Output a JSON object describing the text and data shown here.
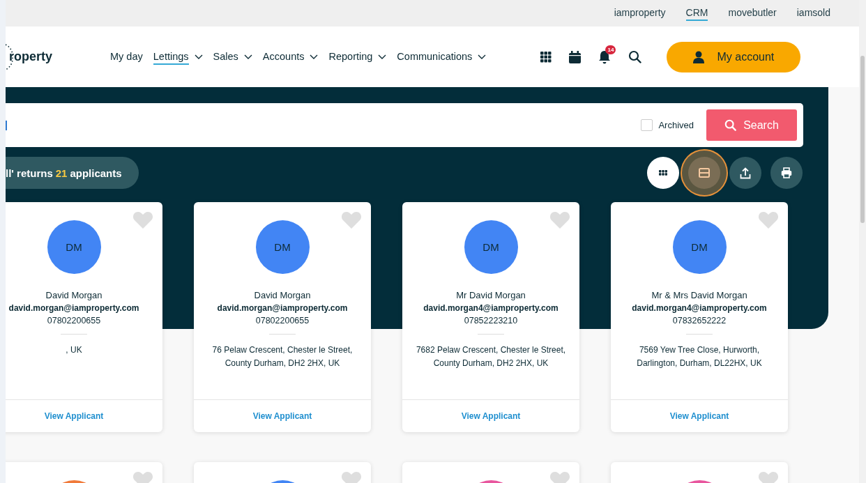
{
  "top_links": [
    {
      "label": "iamproperty",
      "selected": false
    },
    {
      "label": "CRM",
      "selected": true
    },
    {
      "label": "movebutler",
      "selected": false
    },
    {
      "label": "iamsold",
      "selected": false
    }
  ],
  "logo": {
    "text": "roperty"
  },
  "nav": [
    {
      "label": "My day",
      "selected": false,
      "dropdown": false
    },
    {
      "label": "Lettings",
      "selected": true,
      "dropdown": true
    },
    {
      "label": "Sales",
      "selected": false,
      "dropdown": true
    },
    {
      "label": "Accounts",
      "selected": false,
      "dropdown": true
    },
    {
      "label": "Reporting",
      "selected": false,
      "dropdown": true
    },
    {
      "label": "Communications",
      "selected": false,
      "dropdown": true
    }
  ],
  "notification_count": "14",
  "account_button": "My account",
  "search": {
    "archived_label": "Archived",
    "archived_checked": false,
    "button": "Search"
  },
  "results": {
    "prefix": "ll' returns ",
    "count": "21",
    "suffix": " applicants"
  },
  "view_buttons": [
    {
      "kind": "grid",
      "selected": true,
      "focused": false
    },
    {
      "kind": "list",
      "selected": false,
      "focused": true
    },
    {
      "kind": "export",
      "selected": false,
      "focused": false
    },
    {
      "kind": "print",
      "selected": false,
      "focused": false
    }
  ],
  "cards": [
    {
      "initials": "DM",
      "color": "#4285f4",
      "name": "David Morgan",
      "email": "david.morgan@iamproperty.com",
      "phone": "07802200655",
      "address": ", UK",
      "link": "View Applicant"
    },
    {
      "initials": "DM",
      "color": "#4285f4",
      "name": "David Morgan",
      "email": "david.morgan@iamproperty.com",
      "phone": "07802200655",
      "address": "76 Pelaw Crescent, Chester le Street, County Durham, DH2 2HX, UK",
      "link": "View Applicant"
    },
    {
      "initials": "DM",
      "color": "#4285f4",
      "name": "Mr David Morgan",
      "email": "david.morgan4@iamproperty.com",
      "phone": "07852223210",
      "address": "7682 Pelaw Crescent, Chester le Street, County Durham, DH2 2HX, UK",
      "link": "View Applicant"
    },
    {
      "initials": "DM",
      "color": "#4285f4",
      "name": "Mr & Mrs David Morgan",
      "email": "david.morgan4@iamproperty.com",
      "phone": "07832652222",
      "address": "7569 Yew Tree Close, Hurworth, Darlington, Durham, DL22HX, UK",
      "link": "View Applicant"
    }
  ],
  "more_cards": [
    {
      "color": "#f07a3a"
    },
    {
      "color": "#4285f4"
    },
    {
      "color": "#e8569e"
    },
    {
      "color": "#e8569e"
    }
  ]
}
